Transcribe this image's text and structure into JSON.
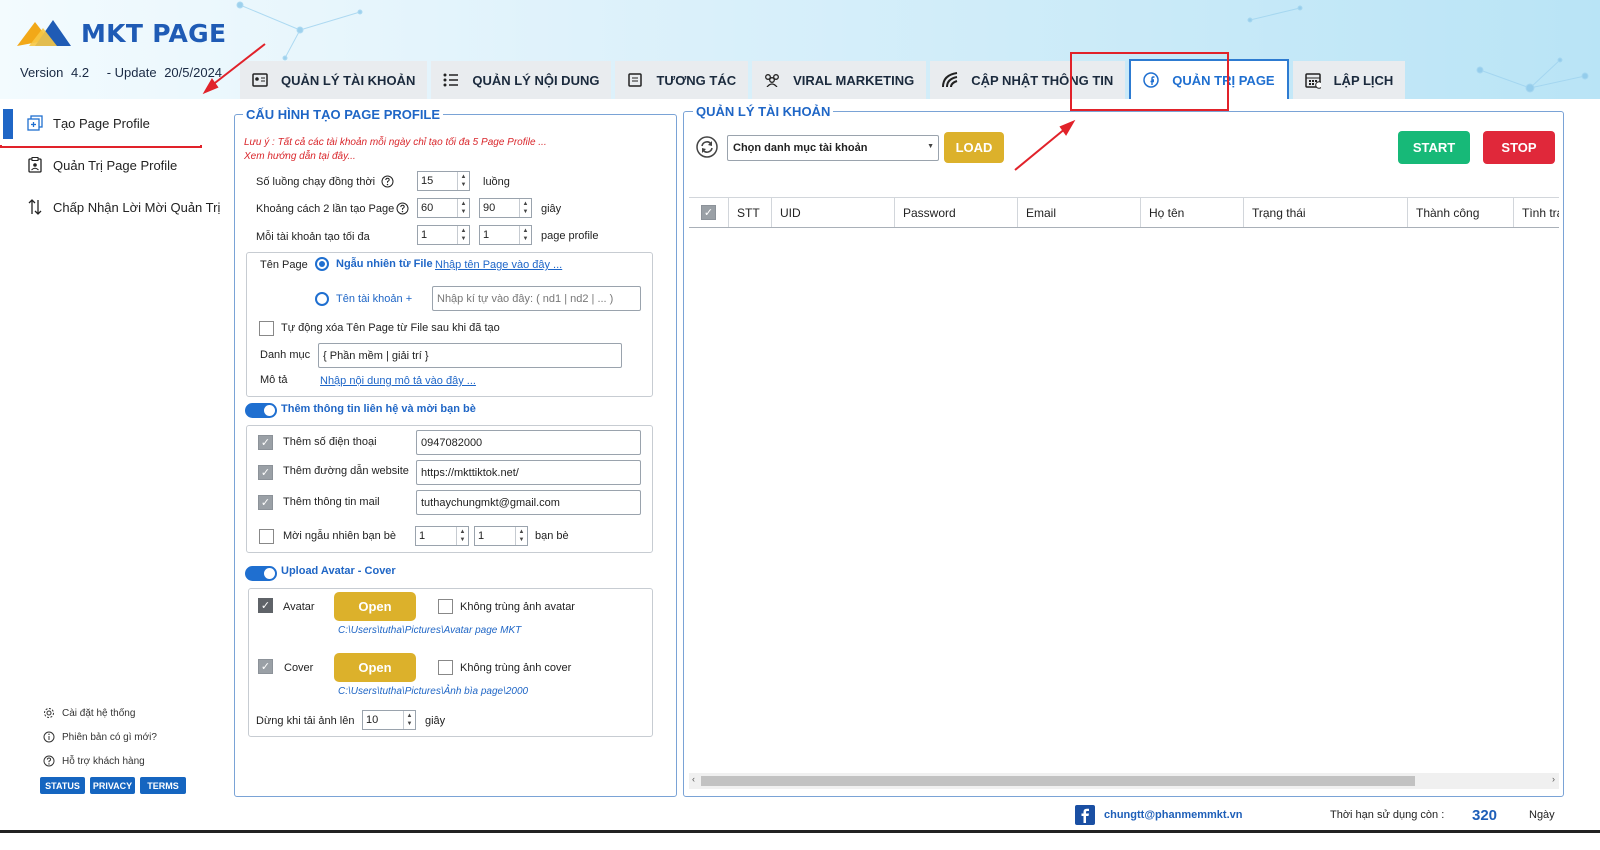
{
  "app": {
    "name": "MKT PAGE",
    "version_label": "Version",
    "version": "4.2",
    "update_label": "- Update",
    "update_date": "20/5/2024"
  },
  "tabs": [
    {
      "label": "QUẢN LÝ TÀI KHOẢN",
      "icon": "id-card-icon",
      "active": false
    },
    {
      "label": "QUẢN LÝ NỘI DUNG",
      "icon": "list-icon",
      "active": false
    },
    {
      "label": "TƯƠNG TÁC",
      "icon": "note-icon",
      "active": false
    },
    {
      "label": "VIRAL MARKETING",
      "icon": "group-icon",
      "active": false
    },
    {
      "label": "CẬP NHẬT THÔNG TIN",
      "icon": "signal-icon",
      "active": false
    },
    {
      "label": "QUẢN TRỊ  PAGE",
      "icon": "facebook-icon",
      "active": true
    },
    {
      "label": "LẬP LỊCH",
      "icon": "calendar-icon",
      "active": false
    }
  ],
  "sidebar": {
    "items": [
      {
        "label": "Tạo Page Profile",
        "icon": "add-page-icon",
        "active": true
      },
      {
        "label": "Quản Trị Page Profile",
        "icon": "admin-clipboard-icon",
        "active": false
      },
      {
        "label": "Chấp Nhận Lời Mời Quản Trị",
        "icon": "sort-arrows-icon",
        "active": false
      }
    ],
    "bottom": [
      {
        "label": "Cài đặt hệ thống",
        "icon": "gear-icon"
      },
      {
        "label": "Phiên bản có gì mới?",
        "icon": "info-icon"
      },
      {
        "label": "Hỗ trợ khách hàng",
        "icon": "help-icon"
      }
    ],
    "pills": [
      "STATUS",
      "PRIVACY",
      "TERMS"
    ]
  },
  "config": {
    "title": "CẤU HÌNH TẠO PAGE PROFILE",
    "note1": "Lưu ý : Tất cả các tài khoản mỗi ngày chỉ tạo tối đa 5 Page Profile ...",
    "note2": "Xem hướng dẫn tại đây...",
    "threads": {
      "label": "Số luồng chạy đồng thời",
      "value": "15",
      "unit": "luồng"
    },
    "interval": {
      "label": "Khoảng cách 2 lần tạo Page",
      "from": "60",
      "to": "90",
      "unit": "giây"
    },
    "max_per_account": {
      "label": "Mỗi tài khoản tạo tối đa",
      "from": "1",
      "to": "1",
      "unit": "page profile"
    },
    "page_name": {
      "label": "Tên Page",
      "opt_random": "Ngẫu nhiên từ File",
      "random_link": "Nhập tên Page vào đây ...",
      "opt_account": "Tên tài khoản +",
      "account_placeholder": "Nhập kí tự vào đây: ( nd1 | nd2 | ... )",
      "autodelete": "Tự động xóa Tên Page từ File sau khi đã tạo",
      "category_label": "Danh mục",
      "category_value": "{ Phần mềm | giải trí }",
      "desc_label": "Mô tả",
      "desc_link": "Nhập nội dung mô tả vào đây ..."
    },
    "contact": {
      "toggle_label": "Thêm thông tin liên hệ và mời bạn bè",
      "phone_label": "Thêm số điện thoại",
      "phone_value": "0947082000",
      "website_label": "Thêm đường dẫn website",
      "website_value": "https://mkttiktok.net/",
      "mail_label": "Thêm thông tin mail",
      "mail_value": "tuthaychungmkt@gmail.com",
      "invite_label": "Mời ngẫu nhiên bạn bè",
      "invite_from": "1",
      "invite_to": "1",
      "invite_unit": "bạn bè"
    },
    "upload": {
      "toggle_label": "Upload Avatar - Cover",
      "avatar_label": "Avatar",
      "open": "Open",
      "avatar_unique": "Không trùng ảnh avatar",
      "avatar_path": "C:\\Users\\tutha\\Pictures\\Avatar page MKT",
      "cover_label": "Cover",
      "cover_unique": "Không trùng ảnh cover",
      "cover_path": "C:\\Users\\tutha\\Pictures\\Ảnh bìa page\\2000",
      "stop_label": "Dừng khi tải ảnh lên",
      "stop_value": "10",
      "stop_unit": "giây"
    }
  },
  "accounts": {
    "title": "QUẢN LÝ TÀI KHOẢN",
    "select_value": "Chọn danh mục tài khoản",
    "load": "LOAD",
    "start": "START",
    "stop": "STOP",
    "columns": [
      "STT",
      "UID",
      "Password",
      "Email",
      "Họ tên",
      "Trạng thái",
      "Thành công",
      "Tình trạ"
    ]
  },
  "footer": {
    "email": "chungtt@phanmemmkt.vn",
    "remaining_label": "Thời hạn sử dụng còn :",
    "remaining_value": "320",
    "remaining_unit": "Ngày"
  },
  "colors": {
    "accent": "#1f6fd0",
    "load": "#dcb12b",
    "start": "#17b978",
    "stop": "#e0283a",
    "highlight": "#e1222a"
  }
}
